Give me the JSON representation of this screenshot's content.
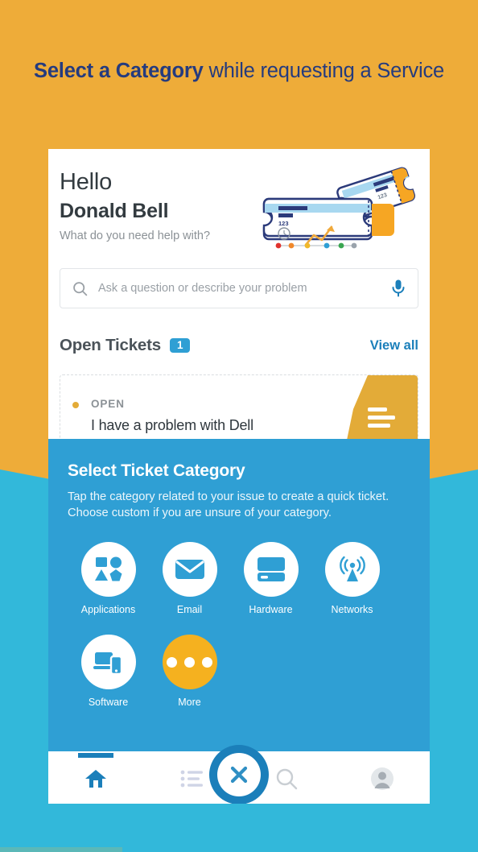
{
  "headline": {
    "bold_part": "Select a Category",
    "rest": " while requesting a Service"
  },
  "colors": {
    "bg_top": "#eeac39",
    "bg_bottom": "#32b8da",
    "headline_text": "#253b7e",
    "accent_blue": "#2f9fd4",
    "accent_orange": "#e3ab38",
    "fab_blue": "#1b7fba"
  },
  "app": {
    "greeting": {
      "hello": "Hello",
      "name": "Donald Bell",
      "subtitle": "What do you need help with?"
    },
    "search": {
      "placeholder": "Ask a question or describe your problem",
      "search_icon": "search-icon",
      "mic_icon": "microphone-icon"
    },
    "open_tickets": {
      "title": "Open Tickets",
      "count": "1",
      "view_all": "View all",
      "ticket": {
        "status": "OPEN",
        "subject": "I have a problem with Dell"
      }
    },
    "category_sheet": {
      "title": "Select Ticket Category",
      "description": "Tap the category related to your issue to create a quick ticket. Choose custom if you are unsure of your category.",
      "categories": [
        {
          "label": "Applications",
          "icon": "shapes-icon",
          "style": "white"
        },
        {
          "label": "Email",
          "icon": "envelope-icon",
          "style": "white"
        },
        {
          "label": "Hardware",
          "icon": "server-icon",
          "style": "white"
        },
        {
          "label": "Networks",
          "icon": "antenna-icon",
          "style": "white"
        },
        {
          "label": "Software",
          "icon": "devices-icon",
          "style": "white"
        },
        {
          "label": "More",
          "icon": "ellipsis-icon",
          "style": "orange"
        }
      ]
    },
    "bottom_nav": {
      "items": [
        {
          "name": "home",
          "icon": "home-icon",
          "active": true
        },
        {
          "name": "tickets",
          "icon": "list-icon",
          "active": false
        },
        {
          "name": "search",
          "icon": "search-icon",
          "active": false
        },
        {
          "name": "profile",
          "icon": "account-icon",
          "active": false
        }
      ],
      "fab": {
        "icon": "close-icon",
        "label": "Close"
      }
    }
  }
}
